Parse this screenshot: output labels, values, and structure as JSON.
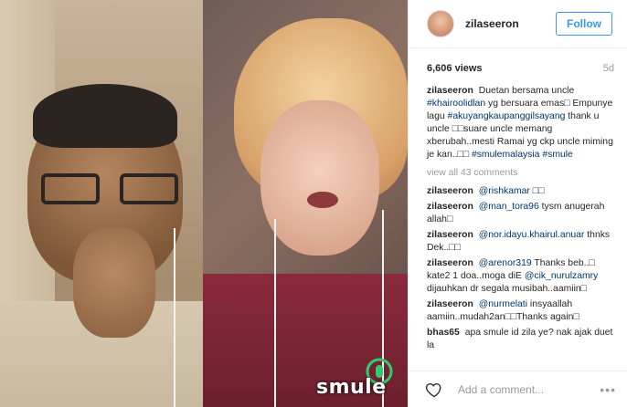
{
  "media": {
    "watermark": "smule"
  },
  "header": {
    "username": "zilaseeron",
    "follow_label": "Follow"
  },
  "stats": {
    "views": "6,606 views",
    "age": "5d"
  },
  "caption": {
    "user": "zilaseeron",
    "text_1": "Duetan bersama uncle",
    "tag_1": "#khairoolidlan",
    "text_2": "yg bersuara emas□ Empunye lagu",
    "tag_2": "#akuyangkaupanggilsayang",
    "text_3": "thank u uncle □□suare uncle memang xberubah..mesti Ramai yg ckp uncle miming je kan..□□",
    "tag_3": "#smulemalaysia",
    "tag_4": "#smule"
  },
  "view_all": "view all 43 comments",
  "comments": [
    {
      "user": "zilaseeron",
      "tag": "@rishkamar",
      "text": "□□"
    },
    {
      "user": "zilaseeron",
      "tag": "@man_tora96",
      "text": "tysm anugerah allah□"
    },
    {
      "user": "zilaseeron",
      "tag": "@nor.idayu.khairul.anuar",
      "text": "thnks Dek..□□"
    },
    {
      "user": "zilaseeron",
      "tag": "@arenor319",
      "text_a": "Thanks beb..□ kate2 1 doa..moga diE",
      "tag_b": "@cik_nurulzamry",
      "text_b": "dijauhkan dr segala musibah..aamiin□"
    },
    {
      "user": "zilaseeron",
      "tag": "@nurmelati",
      "text": "insyaallah aamiin..mudah2an□□Thanks again□"
    },
    {
      "user": "bhas65",
      "tag": "",
      "text": "apa smule id zila ye? nak ajak duet la"
    }
  ],
  "footer": {
    "add_comment_placeholder": "Add a comment...",
    "more_label": "•••"
  },
  "icons": {
    "heart": "heart-icon",
    "more": "more-options-icon",
    "smule": "smule-logo-icon"
  },
  "colors": {
    "follow_blue": "#3897f0",
    "tag_blue": "#003569",
    "muted": "#999999"
  }
}
